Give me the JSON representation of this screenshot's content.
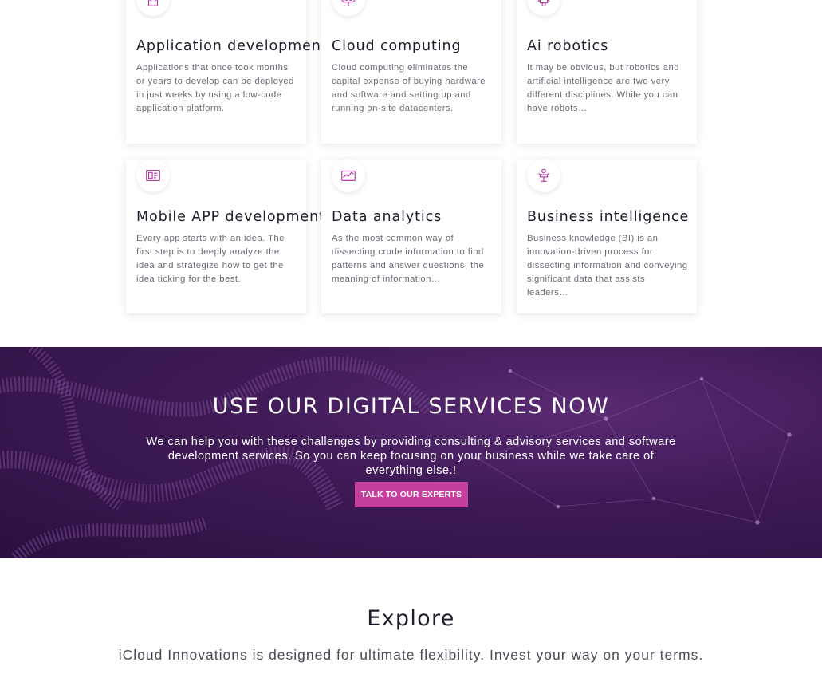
{
  "accent_color": "#b03aa0",
  "cta_color": "#c53f9e",
  "cards": [
    {
      "title": "Application development",
      "text": "Applications that once took months or years to develop can be deployed in just weeks by using a low-code application platform.",
      "icon": "app-code-icon"
    },
    {
      "title": "Cloud computing",
      "text": "Cloud computing eliminates the capital expense of buying hardware and software and setting up and running on-site datacenters.",
      "icon": "cloud-computing-icon"
    },
    {
      "title": "Ai robotics",
      "text": "It may be obvious, but robotics and artificial intelligence are two very different disciplines. While you can have robots…",
      "icon": "robot-icon"
    },
    {
      "title": "Mobile APP development",
      "text": "Every app starts with an idea. The first step is to deeply analyze the idea and strategize how to get the idea ticking for the best.",
      "icon": "mobile-app-icon"
    },
    {
      "title": "Data analytics",
      "text": "As the most common way of dissecting crude information to find patterns and answer questions, the meaning of information…",
      "icon": "data-analytics-icon"
    },
    {
      "title": "Business intelligence",
      "text": "Business knowledge (BI) is an innovation-driven process for dissecting information and conveying significant data that assists leaders…",
      "icon": "business-intelligence-icon"
    }
  ],
  "banner": {
    "title": "USE OUR DIGITAL SERVICES NOW",
    "text": "We can help you with these challenges by providing consulting & advisory services and software development services. So you can keep focusing on your business while we take care of everything else.!",
    "cta_label": "TALK TO OUR EXPERTS"
  },
  "explore": {
    "title": "Explore",
    "text": "iCloud Innovations is designed for ultimate flexibility. Invest your way on your terms."
  }
}
